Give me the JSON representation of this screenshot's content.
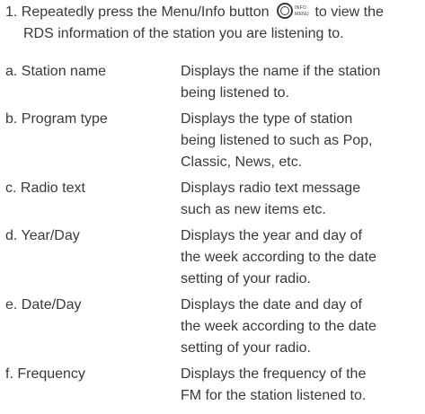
{
  "intro": {
    "prefix": "1. Repeatedly press the Menu/Info button",
    "suffix": "to view the",
    "line2": "RDS information of the station you are listening to.",
    "icon": {
      "name": "menu-info-button-icon",
      "label_top": "INFO",
      "label_bottom": "MENU"
    }
  },
  "items": [
    {
      "term": "a. Station name",
      "desc": [
        "Displays the name if the station",
        "being listened to."
      ]
    },
    {
      "term": "b. Program type",
      "desc": [
        "Displays the type of station",
        "being listened to such as Pop,",
        "Classic, News, etc."
      ]
    },
    {
      "term": "c. Radio text",
      "desc": [
        "Displays radio text message",
        "such as new items etc."
      ]
    },
    {
      "term": "d. Year/Day",
      "desc": [
        "Displays the year and day of",
        "the week according to the date",
        "setting of your radio."
      ]
    },
    {
      "term": "e. Date/Day",
      "desc": [
        "Displays the date and day of",
        "the week according to the date",
        "setting of your radio."
      ]
    },
    {
      "term": "f. Frequency",
      "desc": [
        "Displays the frequency of the",
        "FM for the station listened to."
      ]
    }
  ]
}
